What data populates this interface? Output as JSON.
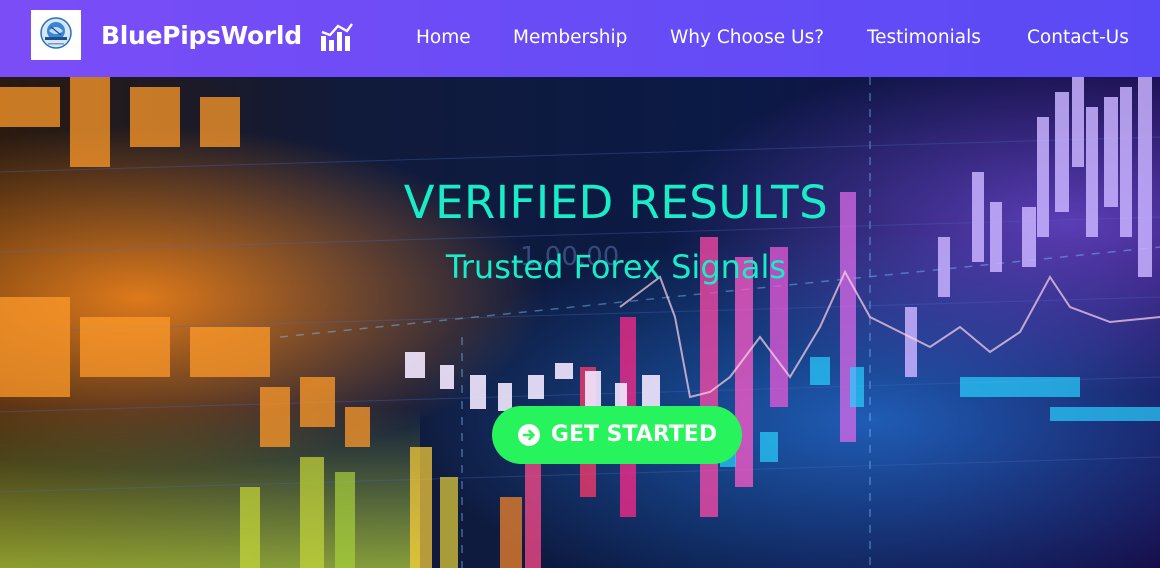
{
  "navbar": {
    "logo_icon": "globe-logo-icon",
    "brand_name": "BluePipsWorld",
    "brand_icon": "bar-chart-icon",
    "links": [
      {
        "label": "Home"
      },
      {
        "label": "Membership"
      },
      {
        "label": "Why Choose Us?"
      },
      {
        "label": "Testimonials"
      },
      {
        "label": "Contact-Us"
      }
    ],
    "colors": {
      "gradient_start": "#7b4df7",
      "gradient_end": "#5a4af5",
      "text": "#ffffff"
    }
  },
  "hero": {
    "title": "VERIFIED RESULTS",
    "subtitle": "Trusted Forex Signals",
    "cta": {
      "label": "GET STARTED",
      "icon": "arrow-circle-right-icon"
    },
    "background": "forex-candlestick-chart-image",
    "colors": {
      "headline": "#18ecc8",
      "cta_background": "#27f35c",
      "cta_text": "#ffffff"
    }
  }
}
